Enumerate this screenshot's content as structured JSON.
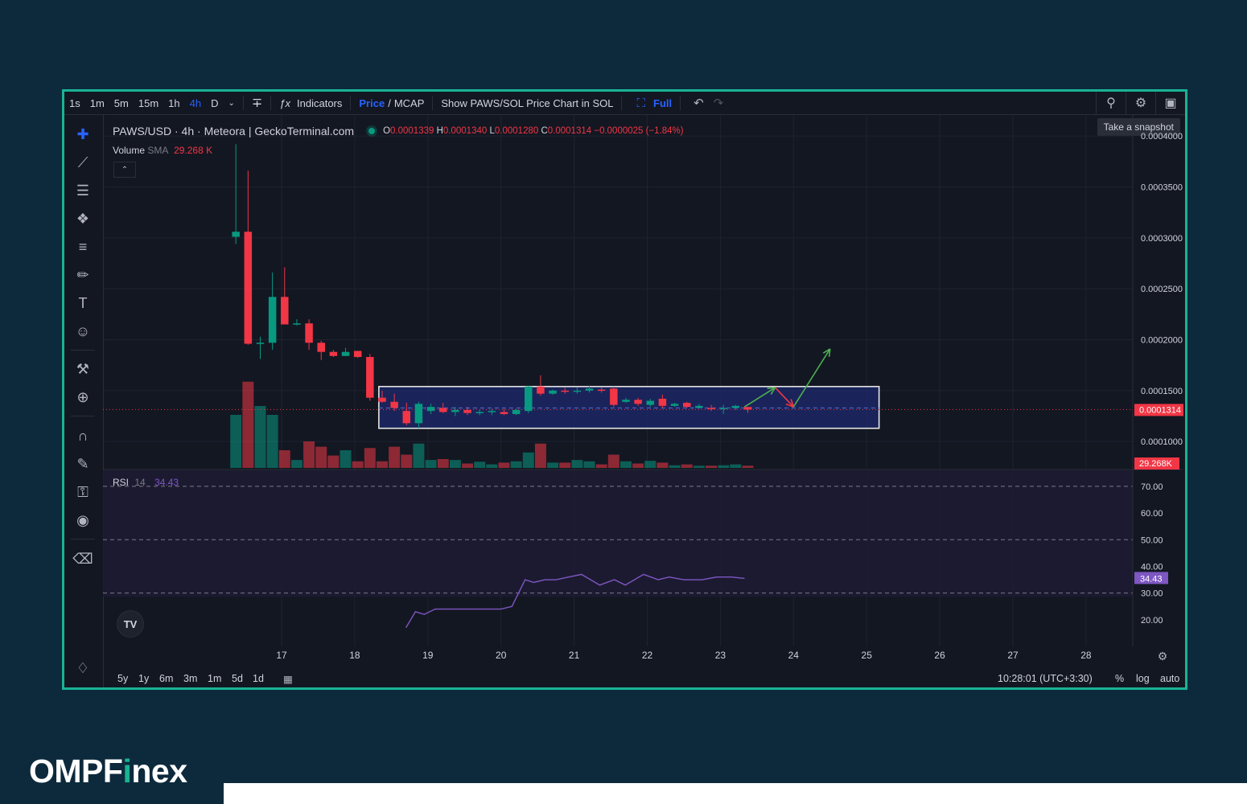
{
  "toolbar": {
    "intervals": [
      "1s",
      "1m",
      "5m",
      "15m",
      "1h",
      "4h",
      "D"
    ],
    "active_interval": "4h",
    "indicators_label": "Indicators",
    "price_label": "Price",
    "price_sep": "/",
    "mcap_label": "MCAP",
    "sol_label": "Show PAWS/SOL Price Chart in SOL",
    "full_label": "Full",
    "tooltip": "Take a snapshot"
  },
  "legend": {
    "title": "PAWS/USD · 4h · Meteora | GeckoTerminal.com",
    "o_key": "O",
    "o_val": "0.0001339",
    "h_key": "H",
    "h_val": "0.0001340",
    "l_key": "L",
    "l_val": "0.0001280",
    "c_key": "C",
    "c_val": "0.0001314",
    "change": "−0.0000025 (−1.84%)",
    "volume_label": "Volume",
    "sma_label": "SMA",
    "volume_value": "29.268 K"
  },
  "rsi": {
    "label": "RSI",
    "period": "14",
    "value": "34.43"
  },
  "bottom": {
    "ranges": [
      "5y",
      "1y",
      "6m",
      "3m",
      "1m",
      "5d",
      "1d"
    ],
    "time": "10:28:01 (UTC+3:30)",
    "pct": "%",
    "log": "log",
    "auto": "auto"
  },
  "brand": {
    "pre": "OMPF",
    "i": "i",
    "post": "nex"
  },
  "colors": {
    "up": "#089981",
    "down": "#f23645",
    "accent": "#19b394",
    "rsi": "#7e57c2",
    "box": "#1e2a6e"
  },
  "chart_data": {
    "type": "candlestick",
    "title": "PAWS/USD · 4h · Meteora | GeckoTerminal.com",
    "price_axis": {
      "ticks": [
        0.0001,
        0.00015,
        0.0002,
        0.00025,
        0.0003,
        0.00035,
        0.0004
      ],
      "tick_labels": [
        "0.0001000",
        "0.0001500",
        "0.0002000",
        "0.0002500",
        "0.0003000",
        "0.0003500",
        "0.0004000"
      ],
      "ylim": [
        7.25e-05,
        0.0004025
      ]
    },
    "last_price_label": "0.0001314",
    "last_price": 0.0001314,
    "volume_label_tag": "29.268K",
    "x_axis": {
      "tick_labels": [
        "17",
        "18",
        "19",
        "20",
        "21",
        "22",
        "23",
        "24",
        "25",
        "26",
        "27",
        "28"
      ],
      "start_day": 16.375
    },
    "candles": [
      {
        "o": 0.000301,
        "h": 0.000392,
        "l": 0.000294,
        "c": 0.000306,
        "v": 1.2
      },
      {
        "o": 0.000306,
        "h": 0.000366,
        "l": 0.000195,
        "c": 0.000196,
        "v": 1.95
      },
      {
        "o": 0.000196,
        "h": 0.000203,
        "l": 0.000181,
        "c": 0.000197,
        "v": 1.4
      },
      {
        "o": 0.000197,
        "h": 0.000266,
        "l": 0.00019,
        "c": 0.000242,
        "v": 1.2
      },
      {
        "o": 0.000242,
        "h": 0.000271,
        "l": 0.00024,
        "c": 0.000215,
        "v": 0.4
      },
      {
        "o": 0.000215,
        "h": 0.00022,
        "l": 0.000214,
        "c": 0.000216,
        "v": 0.18
      },
      {
        "o": 0.000216,
        "h": 0.00022,
        "l": 0.00019,
        "c": 0.000197,
        "v": 0.6
      },
      {
        "o": 0.000197,
        "h": 0.000199,
        "l": 0.00018,
        "c": 0.000188,
        "v": 0.48
      },
      {
        "o": 0.000188,
        "h": 0.00019,
        "l": 0.000183,
        "c": 0.000184,
        "v": 0.28
      },
      {
        "o": 0.000184,
        "h": 0.000192,
        "l": 0.000184,
        "c": 0.000188,
        "v": 0.4
      },
      {
        "o": 0.000189,
        "h": 0.000189,
        "l": 0.000182,
        "c": 0.000183,
        "v": 0.15
      },
      {
        "o": 0.000183,
        "h": 0.000186,
        "l": 0.00014,
        "c": 0.000143,
        "v": 0.45
      },
      {
        "o": 0.000143,
        "h": 0.00015,
        "l": 0.000138,
        "c": 0.000139,
        "v": 0.15
      },
      {
        "o": 0.000139,
        "h": 0.000147,
        "l": 0.00013,
        "c": 0.000133,
        "v": 0.48
      },
      {
        "o": 0.00013,
        "h": 0.000138,
        "l": 0.000116,
        "c": 0.000118,
        "v": 0.3
      },
      {
        "o": 0.000118,
        "h": 0.000139,
        "l": 0.000113,
        "c": 0.000137,
        "v": 0.55
      },
      {
        "o": 0.00013,
        "h": 0.000137,
        "l": 0.000127,
        "c": 0.000134,
        "v": 0.18
      },
      {
        "o": 0.000133,
        "h": 0.000138,
        "l": 0.000128,
        "c": 0.000129,
        "v": 0.2
      },
      {
        "o": 0.000129,
        "h": 0.000134,
        "l": 0.000125,
        "c": 0.000131,
        "v": 0.18
      },
      {
        "o": 0.000131,
        "h": 0.000134,
        "l": 0.000126,
        "c": 0.000128,
        "v": 0.1
      },
      {
        "o": 0.000128,
        "h": 0.000131,
        "l": 0.000126,
        "c": 0.000129,
        "v": 0.14
      },
      {
        "o": 0.000129,
        "h": 0.000132,
        "l": 0.000126,
        "c": 0.00013,
        "v": 0.08
      },
      {
        "o": 0.000129,
        "h": 0.000132,
        "l": 0.000126,
        "c": 0.000127,
        "v": 0.12
      },
      {
        "o": 0.000127,
        "h": 0.000132,
        "l": 0.000126,
        "c": 0.000131,
        "v": 0.15
      },
      {
        "o": 0.00013,
        "h": 0.000155,
        "l": 0.000128,
        "c": 0.000154,
        "v": 0.35
      },
      {
        "o": 0.000154,
        "h": 0.000165,
        "l": 0.000145,
        "c": 0.000147,
        "v": 0.55
      },
      {
        "o": 0.000147,
        "h": 0.000151,
        "l": 0.000146,
        "c": 0.00015,
        "v": 0.12
      },
      {
        "o": 0.00015,
        "h": 0.000153,
        "l": 0.000147,
        "c": 0.000149,
        "v": 0.12
      },
      {
        "o": 0.000149,
        "h": 0.000153,
        "l": 0.000147,
        "c": 0.00015,
        "v": 0.18
      },
      {
        "o": 0.00015,
        "h": 0.000155,
        "l": 0.000148,
        "c": 0.000152,
        "v": 0.15
      },
      {
        "o": 0.000151,
        "h": 0.000153,
        "l": 0.000148,
        "c": 0.00015,
        "v": 0.08
      },
      {
        "o": 0.000152,
        "h": 0.000154,
        "l": 0.000134,
        "c": 0.000136,
        "v": 0.3
      },
      {
        "o": 0.000139,
        "h": 0.000143,
        "l": 0.000138,
        "c": 0.000141,
        "v": 0.15
      },
      {
        "o": 0.000141,
        "h": 0.000143,
        "l": 0.000135,
        "c": 0.000137,
        "v": 0.1
      },
      {
        "o": 0.000136,
        "h": 0.000142,
        "l": 0.000134,
        "c": 0.00014,
        "v": 0.16
      },
      {
        "o": 0.000142,
        "h": 0.000146,
        "l": 0.000133,
        "c": 0.000135,
        "v": 0.12
      },
      {
        "o": 0.000135,
        "h": 0.000138,
        "l": 0.000134,
        "c": 0.000137,
        "v": 0.06
      },
      {
        "o": 0.000138,
        "h": 0.000139,
        "l": 0.000133,
        "c": 0.000134,
        "v": 0.08
      },
      {
        "o": 0.000133,
        "h": 0.000137,
        "l": 0.000133,
        "c": 0.000135,
        "v": 0.05
      },
      {
        "o": 0.000133,
        "h": 0.000136,
        "l": 0.00013,
        "c": 0.000132,
        "v": 0.05
      },
      {
        "o": 0.000132,
        "h": 0.000136,
        "l": 0.000127,
        "c": 0.000133,
        "v": 0.06
      },
      {
        "o": 0.000133,
        "h": 0.000136,
        "l": 0.000131,
        "c": 0.000135,
        "v": 0.08
      },
      {
        "o": 0.0001339,
        "h": 0.000134,
        "l": 0.000128,
        "c": 0.0001314,
        "v": 0.05
      }
    ],
    "range_box": {
      "top": 0.000154,
      "bottom": 0.000113,
      "mid": 0.000133,
      "from_day": 18.33,
      "to_day": 25.17
    },
    "projection": [
      {
        "color": "#4caf50",
        "points": [
          [
            23.33,
            0.000134
          ],
          [
            23.75,
            0.000153
          ]
        ]
      },
      {
        "color": "#f23645",
        "points": [
          [
            23.75,
            0.000153
          ],
          [
            24.0,
            0.000134
          ]
        ]
      },
      {
        "color": "#4caf50",
        "points": [
          [
            24.0,
            0.000134
          ],
          [
            24.5,
            0.000191
          ]
        ]
      }
    ],
    "rsi": {
      "levels": [
        70,
        50,
        30
      ],
      "tick_labels": [
        "70.00",
        "60.00",
        "50.00",
        "40.00",
        "30.00",
        "20.00"
      ],
      "ticks": [
        70,
        60,
        50,
        40,
        30,
        20
      ],
      "ylim": [
        10,
        76
      ],
      "value_label": "34.43",
      "points": [
        [
          18.7,
          17
        ],
        [
          18.83,
          23
        ],
        [
          18.95,
          22
        ],
        [
          19.1,
          24
        ],
        [
          19.5,
          24
        ],
        [
          20.0,
          24
        ],
        [
          20.15,
          25
        ],
        [
          20.33,
          35
        ],
        [
          20.45,
          34
        ],
        [
          20.6,
          35
        ],
        [
          20.75,
          35
        ],
        [
          21.1,
          37
        ],
        [
          21.35,
          33
        ],
        [
          21.55,
          35
        ],
        [
          21.7,
          33
        ],
        [
          21.95,
          37
        ],
        [
          22.15,
          35
        ],
        [
          22.3,
          36
        ],
        [
          22.5,
          35
        ],
        [
          22.75,
          35
        ],
        [
          22.95,
          36
        ],
        [
          23.15,
          36
        ],
        [
          23.33,
          35.5
        ]
      ]
    }
  }
}
